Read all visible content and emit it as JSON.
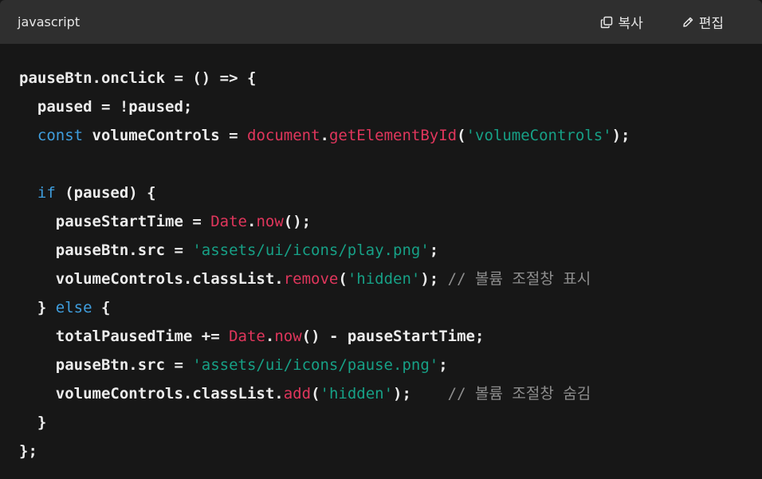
{
  "header": {
    "language": "javascript",
    "copy_label": "복사",
    "edit_label": "편집",
    "copy_icon": "copy-icon",
    "edit_icon": "pencil-icon"
  },
  "code_lines": [
    [
      {
        "t": "pl",
        "v": "pauseBtn.onclick = () => {"
      }
    ],
    [
      {
        "t": "pl",
        "v": "  paused = !paused;"
      }
    ],
    [
      {
        "t": "pl",
        "v": "  "
      },
      {
        "t": "kw",
        "v": "const"
      },
      {
        "t": "pl",
        "v": " volumeControls = "
      },
      {
        "t": "obj",
        "v": "document"
      },
      {
        "t": "pl",
        "v": "."
      },
      {
        "t": "obj",
        "v": "getElementById"
      },
      {
        "t": "pl",
        "v": "("
      },
      {
        "t": "str",
        "v": "'volumeControls'"
      },
      {
        "t": "pl",
        "v": ");"
      }
    ],
    [
      {
        "t": "pl",
        "v": ""
      }
    ],
    [
      {
        "t": "pl",
        "v": "  "
      },
      {
        "t": "kw",
        "v": "if"
      },
      {
        "t": "pl",
        "v": " (paused) {"
      }
    ],
    [
      {
        "t": "pl",
        "v": "    pauseStartTime = "
      },
      {
        "t": "obj",
        "v": "Date"
      },
      {
        "t": "pl",
        "v": "."
      },
      {
        "t": "obj",
        "v": "now"
      },
      {
        "t": "pl",
        "v": "();"
      }
    ],
    [
      {
        "t": "pl",
        "v": "    pauseBtn.src = "
      },
      {
        "t": "str",
        "v": "'assets/ui/icons/play.png'"
      },
      {
        "t": "pl",
        "v": ";"
      }
    ],
    [
      {
        "t": "pl",
        "v": "    volumeControls.classList."
      },
      {
        "t": "obj",
        "v": "remove"
      },
      {
        "t": "pl",
        "v": "("
      },
      {
        "t": "str",
        "v": "'hidden'"
      },
      {
        "t": "pl",
        "v": "); "
      },
      {
        "t": "cmt",
        "v": "// 볼륨 조절창 표시"
      }
    ],
    [
      {
        "t": "pl",
        "v": "  } "
      },
      {
        "t": "kw",
        "v": "else"
      },
      {
        "t": "pl",
        "v": " {"
      }
    ],
    [
      {
        "t": "pl",
        "v": "    totalPausedTime += "
      },
      {
        "t": "obj",
        "v": "Date"
      },
      {
        "t": "pl",
        "v": "."
      },
      {
        "t": "obj",
        "v": "now"
      },
      {
        "t": "pl",
        "v": "() - pauseStartTime;"
      }
    ],
    [
      {
        "t": "pl",
        "v": "    pauseBtn.src = "
      },
      {
        "t": "str",
        "v": "'assets/ui/icons/pause.png'"
      },
      {
        "t": "pl",
        "v": ";"
      }
    ],
    [
      {
        "t": "pl",
        "v": "    volumeControls.classList."
      },
      {
        "t": "obj",
        "v": "add"
      },
      {
        "t": "pl",
        "v": "("
      },
      {
        "t": "str",
        "v": "'hidden'"
      },
      {
        "t": "pl",
        "v": ");    "
      },
      {
        "t": "cmt",
        "v": "// 볼륨 조절창 숨김"
      }
    ],
    [
      {
        "t": "pl",
        "v": "  }"
      }
    ],
    [
      {
        "t": "pl",
        "v": "};"
      }
    ]
  ],
  "colors": {
    "background": "#171717",
    "header_background": "#2f2f2f",
    "keyword": "#3f9ede",
    "object": "#e0365c",
    "string": "#17a086",
    "comment": "#8e8e8e",
    "plain": "#ececec"
  }
}
